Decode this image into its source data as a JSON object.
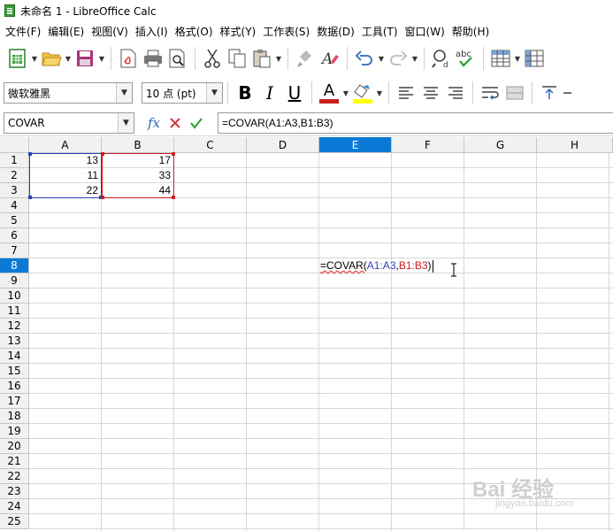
{
  "window": {
    "title": "未命名 1 - LibreOffice Calc"
  },
  "menu": [
    "文件(F)",
    "编辑(E)",
    "视图(V)",
    "插入(I)",
    "格式(O)",
    "样式(Y)",
    "工作表(S)",
    "数据(D)",
    "工具(T)",
    "窗口(W)",
    "帮助(H)"
  ],
  "format_toolbar": {
    "font_name": "微软雅黑",
    "font_size": "10 点 (pt)",
    "bold_label": "B",
    "italic_label": "I",
    "underline_label": "U",
    "font_color_label": "A",
    "colors": {
      "font_color": "#c9211e",
      "highlight": "#ffff00"
    }
  },
  "standard_toolbar": {
    "icons": [
      "new-spreadsheet-icon",
      "open-folder-icon",
      "save-icon",
      "export-pdf-icon",
      "print-icon",
      "print-preview-icon",
      "cut-icon",
      "copy-icon",
      "paste-icon",
      "clone-formatting-icon",
      "clear-formatting-icon",
      "undo-icon",
      "redo-icon",
      "find-replace-icon",
      "spellcheck-icon",
      "row-icon",
      "column-icon"
    ],
    "spellcheck_label": "abc"
  },
  "formula_bar": {
    "name_box": "COVAR",
    "function_label": "fx",
    "formula": "=COVAR(A1:A3,B1:B3)"
  },
  "sheet": {
    "columns": [
      "A",
      "B",
      "C",
      "D",
      "E",
      "F",
      "G",
      "H"
    ],
    "selected_column": "E",
    "rows": [
      "1",
      "2",
      "3",
      "4",
      "5",
      "6",
      "7",
      "8",
      "9",
      "10",
      "11",
      "12",
      "13",
      "14",
      "15",
      "16",
      "17",
      "18",
      "19",
      "20",
      "21",
      "22",
      "23",
      "24",
      "25"
    ],
    "selected_row": "8",
    "cells": {
      "A1": "13",
      "A2": "11",
      "A3": "22",
      "B1": "17",
      "B2": "33",
      "B3": "44"
    },
    "editing_cell": {
      "prefix": "=COVAR(",
      "ref1": "A1:A3",
      "comma": ",",
      "ref2": "B1:B3",
      "suffix": ")"
    },
    "ref_colors": {
      "ref1": "#2c3fb8",
      "ref2": "#cc1f1f"
    }
  },
  "watermark": {
    "text": "Bai 经验",
    "sub": "jingyan.baidu.com"
  }
}
